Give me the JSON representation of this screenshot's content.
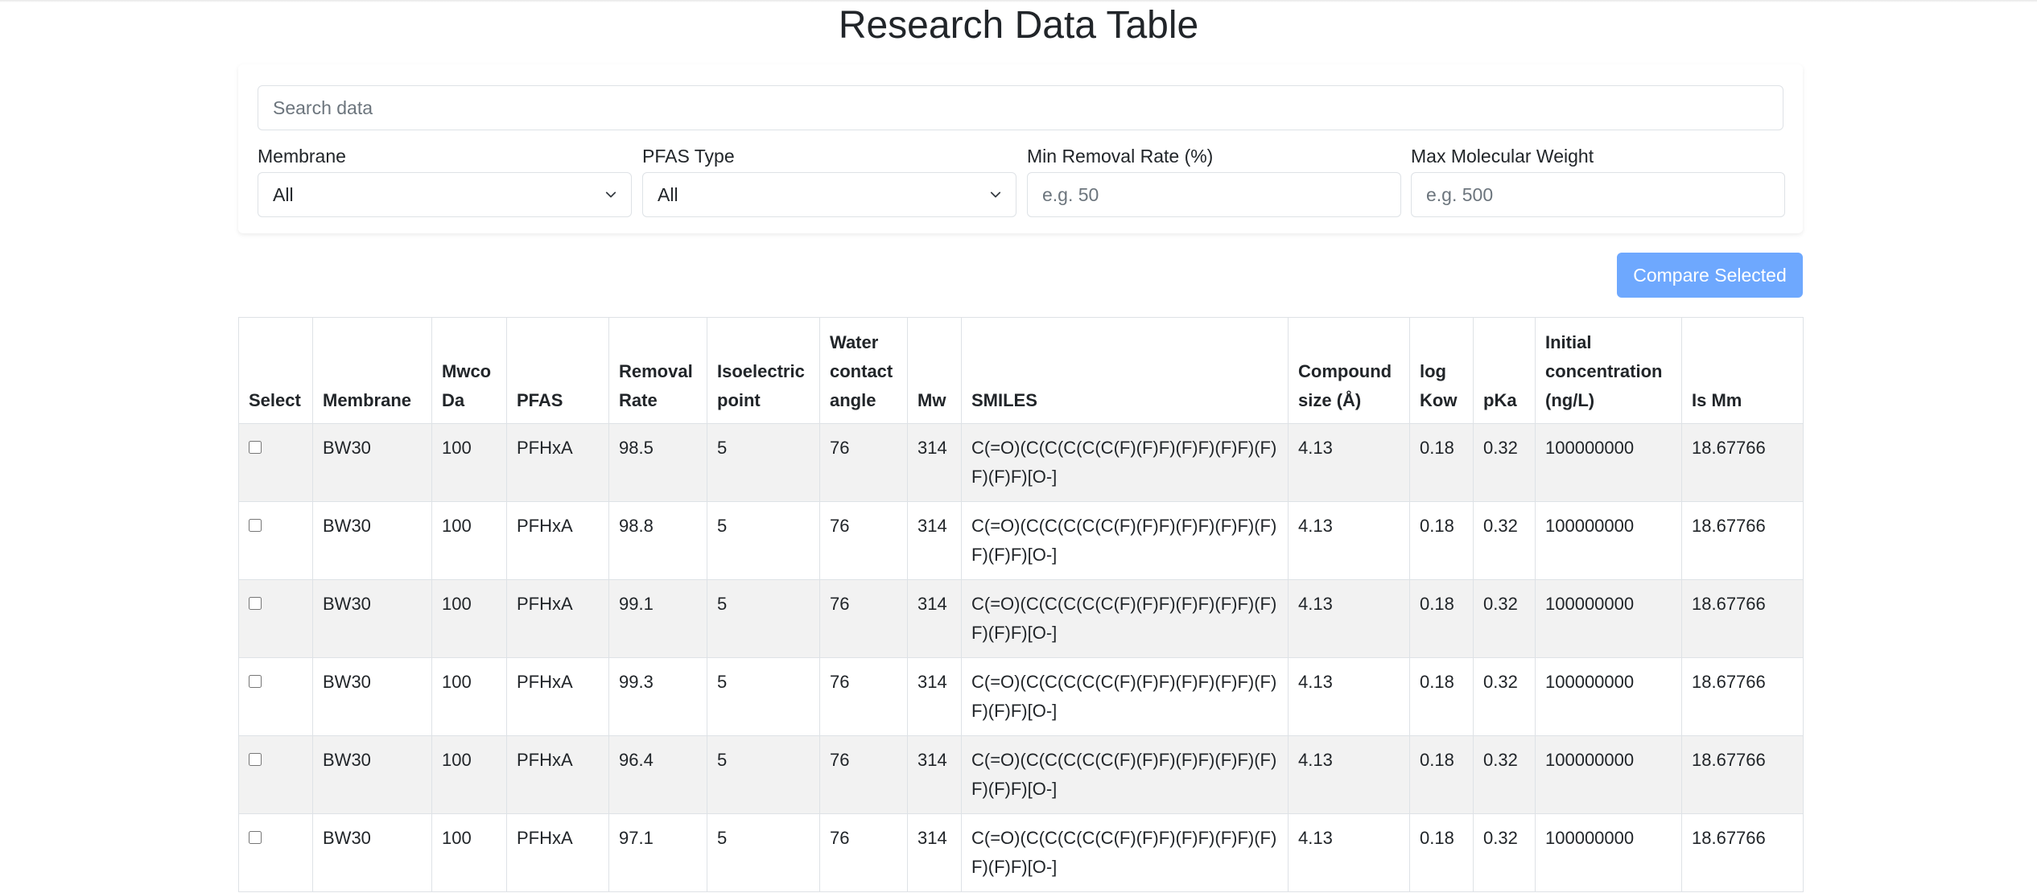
{
  "page": {
    "title": "Research Data Table"
  },
  "filters": {
    "search_placeholder": "Search data",
    "membrane": {
      "label": "Membrane",
      "value": "All"
    },
    "pfas_type": {
      "label": "PFAS Type",
      "value": "All"
    },
    "min_removal": {
      "label": "Min Removal Rate (%)",
      "placeholder": "e.g. 50"
    },
    "max_mw": {
      "label": "Max Molecular Weight",
      "placeholder": "e.g. 500"
    }
  },
  "actions": {
    "compare_label": "Compare Selected"
  },
  "colors": {
    "accent": "#6ea8fe",
    "stripe": "#f2f2f2",
    "border": "#dee2e6"
  },
  "icons": {
    "select_chevron": "chevron-down-icon"
  },
  "table": {
    "headers": [
      "Select",
      "Membrane",
      "Mwco Da",
      "PFAS",
      "Removal Rate",
      "Isoelectric point",
      "Water contact angle",
      "Mw",
      "SMILES",
      "Compound size (Å)",
      "log Kow",
      "pKa",
      "Initial concentration (ng/L)",
      "Is Mm"
    ],
    "rows": [
      {
        "checked": false,
        "membrane": "BW30",
        "mwco": "100",
        "pfas": "PFHxA",
        "removal": "98.5",
        "iep": "5",
        "angle": "76",
        "mw": "314",
        "smiles": "C(=O)(C(C(C(C(C(F)(F)F)(F)F)(F)F)(F)F)(F)F)[O-]",
        "size": "4.13",
        "logkow": "0.18",
        "pka": "0.32",
        "conc": "100000000",
        "ismm": "18.67766"
      },
      {
        "checked": false,
        "membrane": "BW30",
        "mwco": "100",
        "pfas": "PFHxA",
        "removal": "98.8",
        "iep": "5",
        "angle": "76",
        "mw": "314",
        "smiles": "C(=O)(C(C(C(C(C(F)(F)F)(F)F)(F)F)(F)F)(F)F)[O-]",
        "size": "4.13",
        "logkow": "0.18",
        "pka": "0.32",
        "conc": "100000000",
        "ismm": "18.67766"
      },
      {
        "checked": false,
        "membrane": "BW30",
        "mwco": "100",
        "pfas": "PFHxA",
        "removal": "99.1",
        "iep": "5",
        "angle": "76",
        "mw": "314",
        "smiles": "C(=O)(C(C(C(C(C(F)(F)F)(F)F)(F)F)(F)F)(F)F)[O-]",
        "size": "4.13",
        "logkow": "0.18",
        "pka": "0.32",
        "conc": "100000000",
        "ismm": "18.67766"
      },
      {
        "checked": false,
        "membrane": "BW30",
        "mwco": "100",
        "pfas": "PFHxA",
        "removal": "99.3",
        "iep": "5",
        "angle": "76",
        "mw": "314",
        "smiles": "C(=O)(C(C(C(C(C(F)(F)F)(F)F)(F)F)(F)F)(F)F)[O-]",
        "size": "4.13",
        "logkow": "0.18",
        "pka": "0.32",
        "conc": "100000000",
        "ismm": "18.67766"
      },
      {
        "checked": false,
        "membrane": "BW30",
        "mwco": "100",
        "pfas": "PFHxA",
        "removal": "96.4",
        "iep": "5",
        "angle": "76",
        "mw": "314",
        "smiles": "C(=O)(C(C(C(C(C(F)(F)F)(F)F)(F)F)(F)F)(F)F)[O-]",
        "size": "4.13",
        "logkow": "0.18",
        "pka": "0.32",
        "conc": "100000000",
        "ismm": "18.67766"
      },
      {
        "checked": false,
        "membrane": "BW30",
        "mwco": "100",
        "pfas": "PFHxA",
        "removal": "97.1",
        "iep": "5",
        "angle": "76",
        "mw": "314",
        "smiles": "C(=O)(C(C(C(C(C(F)(F)F)(F)F)(F)F)(F)F)(F)F)[O-]",
        "size": "4.13",
        "logkow": "0.18",
        "pka": "0.32",
        "conc": "100000000",
        "ismm": "18.67766"
      }
    ]
  }
}
